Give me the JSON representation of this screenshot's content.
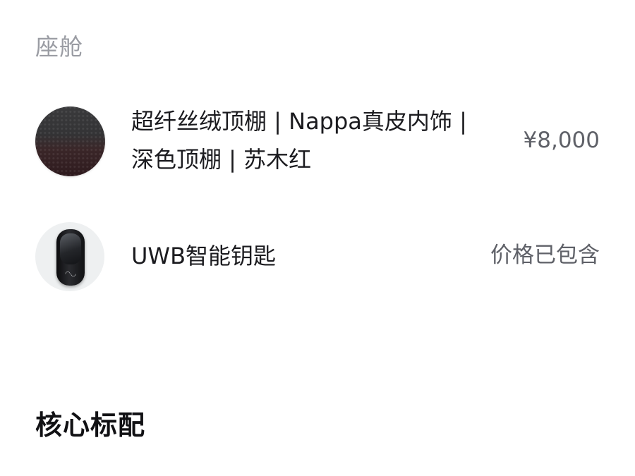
{
  "cabin_section": {
    "label": "座舱",
    "items": [
      {
        "title": "超纤丝绒顶棚 | Nappa真皮内饰 | 深色顶棚 | 苏木红",
        "price": "¥8,000",
        "thumbnail": "interior-material-swatch"
      },
      {
        "title": "UWB智能钥匙",
        "price": "价格已包含",
        "thumbnail": "smart-key"
      }
    ]
  },
  "core_standard_section": {
    "heading": "核心标配"
  },
  "colors": {
    "section_label": "#9a9ca3",
    "text_primary": "#1b1b1f",
    "price_text": "#5f6168",
    "swatch_red": "#2e1a1e"
  }
}
